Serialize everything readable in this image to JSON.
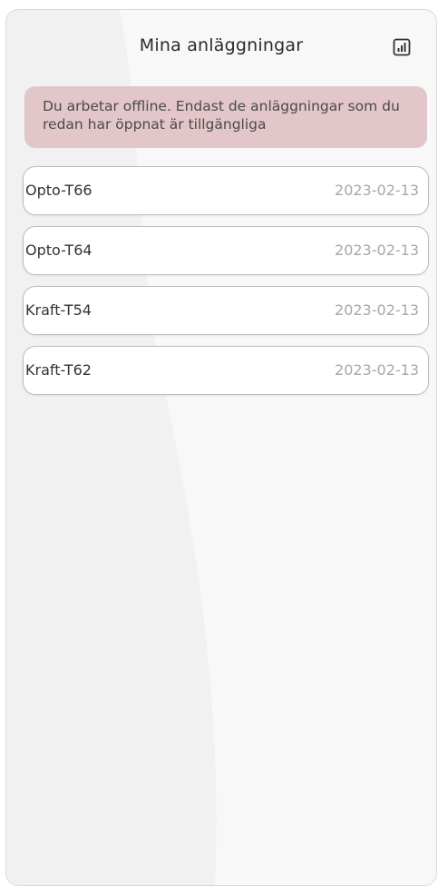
{
  "header": {
    "title": "Mina anläggningar",
    "stats_icon": "bar-chart-icon"
  },
  "banner": {
    "text": "Du arbetar offline. Endast de anläggningar som du redan har öppnat är tillgängliga",
    "color": "#e2c6c9"
  },
  "facilities": [
    {
      "name": "Opto-T66",
      "date": "2023-02-13"
    },
    {
      "name": "Opto-T64",
      "date": "2023-02-13"
    },
    {
      "name": "Kraft-T54",
      "date": "2023-02-13"
    },
    {
      "name": "Kraft-T62",
      "date": "2023-02-13"
    }
  ]
}
